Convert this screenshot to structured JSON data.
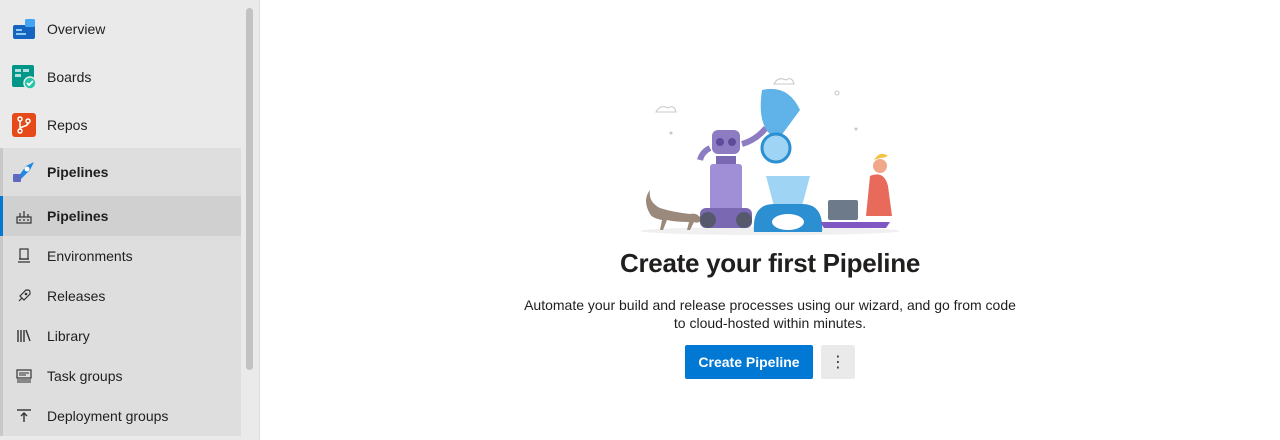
{
  "sidebar": {
    "items": [
      {
        "label": "Overview",
        "icon": "overview-icon"
      },
      {
        "label": "Boards",
        "icon": "boards-icon"
      },
      {
        "label": "Repos",
        "icon": "repos-icon"
      }
    ],
    "group": {
      "label": "Pipelines",
      "icon": "pipelines-icon",
      "children": [
        {
          "label": "Pipelines",
          "icon": "pipelines-list-icon",
          "selected": true
        },
        {
          "label": "Environments",
          "icon": "environments-icon"
        },
        {
          "label": "Releases",
          "icon": "releases-rocket-icon"
        },
        {
          "label": "Library",
          "icon": "library-icon"
        },
        {
          "label": "Task groups",
          "icon": "task-groups-icon"
        },
        {
          "label": "Deployment groups",
          "icon": "deployment-groups-icon"
        }
      ]
    }
  },
  "main": {
    "title": "Create your first Pipeline",
    "description": "Automate your build and release processes using our wizard, and go from code to cloud-hosted within minutes.",
    "primary_button": "Create Pipeline",
    "more_button": "⋮"
  },
  "colors": {
    "accent": "#0078d4",
    "sidebar_bg": "#eaeaea"
  }
}
